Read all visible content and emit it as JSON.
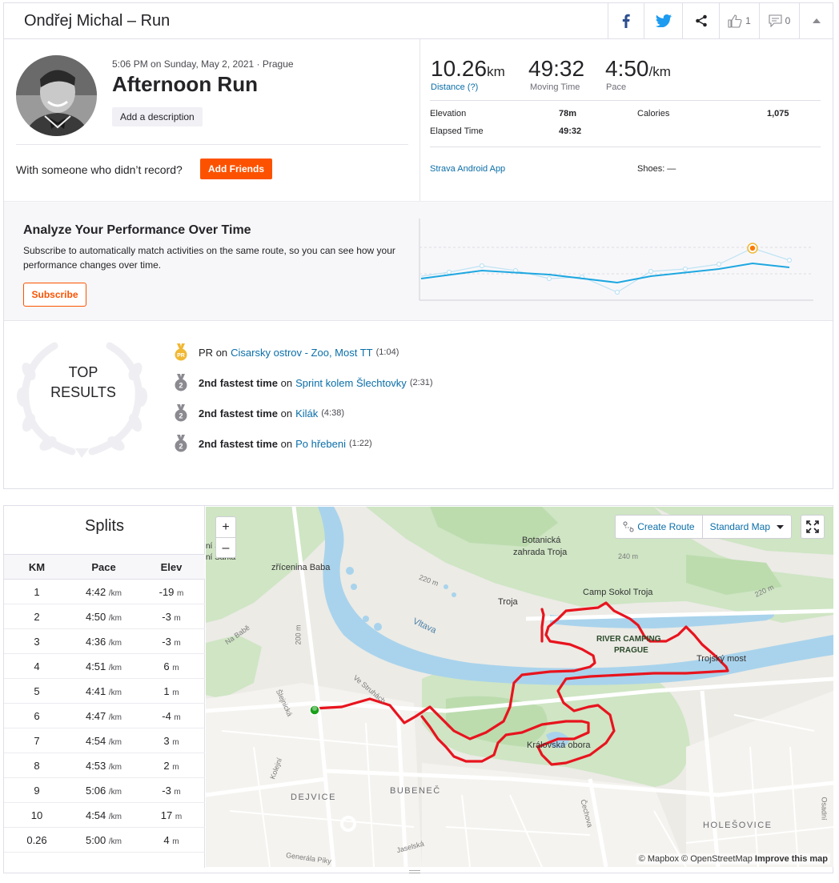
{
  "header": {
    "title": "Ondřej Michal – Run",
    "kudos_count": "1",
    "comment_count": "0"
  },
  "activity": {
    "date_line": "5:06 PM on Sunday, May 2, 2021 · Prague",
    "title": "Afternoon Run",
    "add_description": "Add a description",
    "with_someone": "With someone who didn’t record?",
    "add_friends": "Add Friends"
  },
  "stats": {
    "distance_value": "10.26",
    "distance_unit": "km",
    "distance_label": "Distance (?)",
    "moving_time_value": "49:32",
    "moving_time_label": "Moving Time",
    "pace_value": "4:50",
    "pace_unit": "/km",
    "pace_label": "Pace",
    "elevation_label": "Elevation",
    "elevation_value": "78m",
    "elapsed_label": "Elapsed Time",
    "elapsed_value": "49:32",
    "calories_label": "Calories",
    "calories_value": "1,075",
    "device": "Strava Android App",
    "shoes": "Shoes: —"
  },
  "analyze": {
    "title": "Analyze Your Performance Over Time",
    "text": "Subscribe to automatically match activities on the same route, so you can see how your performance changes over time.",
    "subscribe_label": "Subscribe"
  },
  "top_results": {
    "heading_line1": "TOP",
    "heading_line2": "RESULTS",
    "items": [
      {
        "medal": "PR",
        "prefix": "PR",
        "on": "on",
        "segment": "Cisarsky ostrov - Zoo, Most TT",
        "time": "(1:04)"
      },
      {
        "medal": "2",
        "prefix": "2nd fastest time",
        "on": "on",
        "segment": "Sprint kolem Šlechtovky",
        "time": "(2:31)"
      },
      {
        "medal": "2",
        "prefix": "2nd fastest time",
        "on": "on",
        "segment": "Kilák",
        "time": "(4:38)"
      },
      {
        "medal": "2",
        "prefix": "2nd fastest time",
        "on": "on",
        "segment": "Po hřebeni",
        "time": "(1:22)"
      }
    ]
  },
  "splits": {
    "title": "Splits",
    "headers": [
      "KM",
      "Pace",
      "Elev"
    ],
    "pace_unit": "/km",
    "elev_unit": "m",
    "rows": [
      {
        "km": "1",
        "pace": "4:42",
        "elev": "-19"
      },
      {
        "km": "2",
        "pace": "4:50",
        "elev": "-3"
      },
      {
        "km": "3",
        "pace": "4:36",
        "elev": "-3"
      },
      {
        "km": "4",
        "pace": "4:51",
        "elev": "6"
      },
      {
        "km": "5",
        "pace": "4:41",
        "elev": "1"
      },
      {
        "km": "6",
        "pace": "4:47",
        "elev": "-4"
      },
      {
        "km": "7",
        "pace": "4:54",
        "elev": "3"
      },
      {
        "km": "8",
        "pace": "4:53",
        "elev": "2"
      },
      {
        "km": "9",
        "pace": "5:06",
        "elev": "-3"
      },
      {
        "km": "10",
        "pace": "4:54",
        "elev": "17"
      },
      {
        "km": "0.26",
        "pace": "5:00",
        "elev": "4"
      }
    ]
  },
  "map": {
    "zoom_in": "+",
    "zoom_out": "–",
    "create_route": "Create Route",
    "map_type": "Standard Map",
    "attribution_mapbox": "© Mapbox",
    "attribution_osm": "© OpenStreetMap",
    "improve": "Improve this map",
    "labels": {
      "botanicka": "Botanická",
      "zahrada": "zahrada Troja",
      "zricenina": "zřícenina Baba",
      "troja": "Troja",
      "camp_sokol": "Camp Sokol Troja",
      "river_camping": "RIVER CAMPING",
      "prague": "PRAGUE",
      "trojsky_most": "Trojský most",
      "vltava": "Vltava",
      "kralovska": "Královská obora",
      "dejvice": "DEJVICE",
      "bubenec": "BUBENEČ",
      "holesovice": "HOLEŠOVICE",
      "na_babe": "Na Babě",
      "ve_struhach": "Ve Struhách",
      "slejnicka": "Šlejnická",
      "kolejni": "Kolejní",
      "cechova": "Čechova",
      "jaselska": "Jaselská",
      "generala": "Generála Píky",
      "osadni": "Osadní",
      "sarka1": "ní Šárka",
      "sarka2": "ní Šárka",
      "e240_1": "240 m",
      "e220_1": "220 m",
      "e220_2": "220 m",
      "e200": "200 m"
    }
  },
  "colors": {
    "accent": "#fc5200",
    "link": "#0a6ea8",
    "route": "#e8141e",
    "trend": "#1ea7e0",
    "pr_gold": "#f0b833",
    "medal_gray": "#8a8a90"
  }
}
